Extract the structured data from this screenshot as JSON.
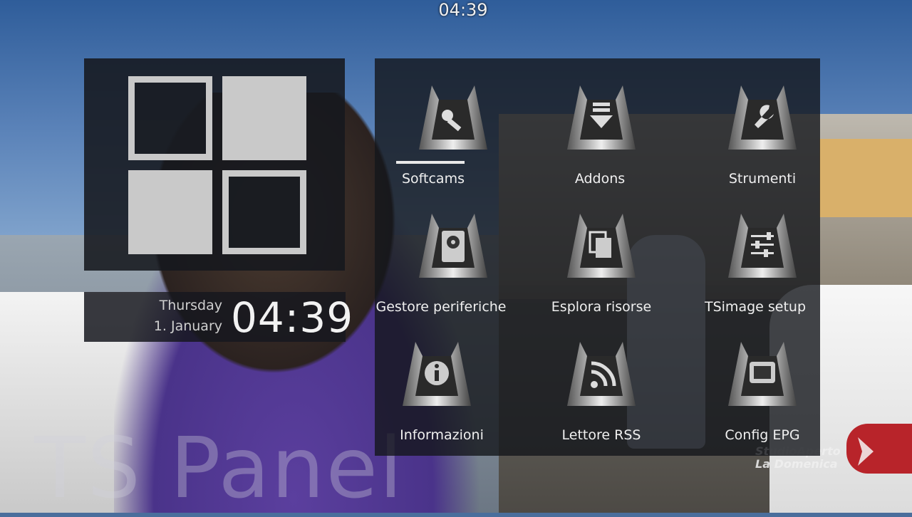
{
  "top_clock": "04:39",
  "date_panel": {
    "day": "Thursday",
    "date": "1. January",
    "time": "04:39"
  },
  "menu": {
    "selected_index": 0,
    "items": [
      {
        "label": "Softcams",
        "icon": "softcam-icon"
      },
      {
        "label": "Addons",
        "icon": "download-icon"
      },
      {
        "label": "Strumenti",
        "icon": "wrench-icon"
      },
      {
        "label": "Gestore periferiche",
        "icon": "hard-drive-icon"
      },
      {
        "label": "Esplora risorse",
        "icon": "folder-files-icon"
      },
      {
        "label": "TSimage setup",
        "icon": "sliders-icon"
      },
      {
        "label": "Informazioni",
        "icon": "info-icon"
      },
      {
        "label": "Lettore RSS",
        "icon": "rss-icon"
      },
      {
        "label": "Config EPG",
        "icon": "tv-icon"
      }
    ]
  },
  "watermark": "TS Panel",
  "channel_logo": {
    "line1": "StudioAperto",
    "line2": "La Domenica"
  },
  "colors": {
    "tile": "#c9c9c9",
    "panel": "#16181e",
    "text": "#f0f0f0"
  }
}
